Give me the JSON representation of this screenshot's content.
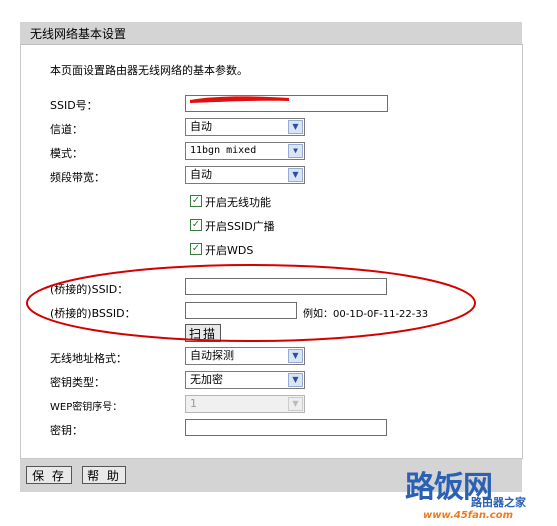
{
  "panel": {
    "title": "无线网络基本设置",
    "description": "本页面设置路由器无线网络的基本参数。"
  },
  "fields": {
    "ssid_label": "SSID号：",
    "ssid_value": "",
    "channel_label": "信道：",
    "channel_value": "自动",
    "mode_label": "模式：",
    "mode_value": "11bgn mixed",
    "bandwidth_label": "频段带宽：",
    "bandwidth_value": "自动",
    "enable_wireless_label": "开启无线功能",
    "enable_ssid_broadcast_label": "开启SSID广播",
    "enable_wds_label": "开启WDS",
    "bridged_ssid_label": "(桥接的)SSID：",
    "bridged_ssid_value": "",
    "bridged_bssid_label": "(桥接的)BSSID：",
    "bridged_bssid_value": "",
    "bssid_example": "例如：00-1D-0F-11-22-33",
    "scan_button": "扫描",
    "address_format_label": "无线地址格式：",
    "address_format_value": "自动探测",
    "key_type_label": "密钥类型：",
    "key_type_value": "无加密",
    "wep_index_label": "WEP密钥序号：",
    "wep_index_value": "1",
    "key_label": "密钥：",
    "key_value": ""
  },
  "checkboxes": {
    "enable_wireless": true,
    "enable_ssid_broadcast": true,
    "enable_wds": true
  },
  "buttons": {
    "save": "保 存",
    "help": "帮 助"
  },
  "watermark": {
    "brand": "路饭网",
    "subtitle": "路由器之家",
    "url": "www.45fan.com"
  },
  "colors": {
    "annotation_red": "#d40000",
    "header_gray": "#d4d4d4",
    "watermark_blue": "#2b61b5",
    "watermark_orange": "#f07a1e"
  },
  "icons": {
    "checkbox_checked": "check-icon",
    "dropdown": "chevron-down-icon"
  }
}
